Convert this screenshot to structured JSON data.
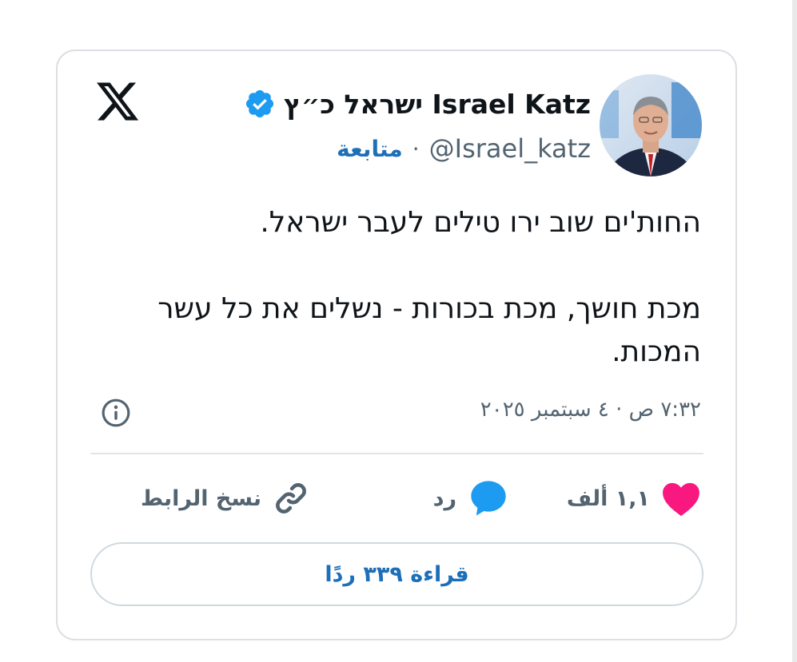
{
  "top_glyph": "ْ",
  "author": {
    "display_name": "ישראל כ״ץ Israel Katz",
    "handle": "@Israel_katz",
    "follow_label": "متابعة",
    "separator": "·",
    "verified": true,
    "accent_color": "#1d9bf0"
  },
  "tweet": {
    "lines": [
      "החות'ים שוב ירו טילים לעבר ישראל.",
      "מכת חושך, מכת בכורות - נשלים את כל עשר",
      "המכות."
    ],
    "timestamp": "٧:٣٢ ص · ٤ سبتمبر ٢٠٢٥"
  },
  "actions": {
    "likes": "١,١ ألف",
    "reply_label": "رد",
    "copy_link_label": "نسخ الرابط",
    "like_color": "#f91880",
    "reply_color": "#1d9bf0"
  },
  "read_replies_label": "قراءة ٣٣٩ ردًا",
  "icons": {
    "logo": "x-logo-icon",
    "verified": "verified-badge-icon",
    "info": "info-icon",
    "like": "heart-icon",
    "reply": "speech-bubble-icon",
    "copy": "link-icon"
  }
}
